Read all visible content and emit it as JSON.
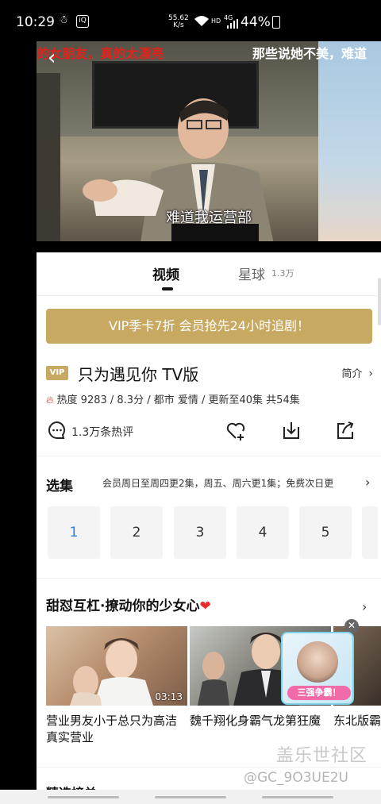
{
  "status_bar": {
    "time": "10:29",
    "net_speed_value": "55.62",
    "net_speed_unit": "K/s",
    "hd": "HD",
    "network": "4G",
    "battery": "44%"
  },
  "video": {
    "marquee_left": "的女朋友，真的太漂亮",
    "marquee_right": "那些说她不美，难道",
    "subtitle": "难道我运营部"
  },
  "tabs": {
    "video": "视频",
    "star": "星球",
    "star_count": "1.3万"
  },
  "vip_banner": "VIP季卡7折 会员抢先24小时追剧！",
  "show": {
    "vip_badge": "VIP",
    "title": "只为遇见你 TV版",
    "intro": "简介",
    "meta": "热度 9283 / 8.3分 / 都市 爱情 / 更新至40集 共54集",
    "comments": "1.3万条热评"
  },
  "episodes": {
    "heading": "选集",
    "note": "会员周日至周四更2集，周五、周六更1集；免费次日更",
    "list": [
      "1",
      "2",
      "3",
      "4",
      "5"
    ]
  },
  "recommend": {
    "heading": "甜怼互杠·撩动你的少女心",
    "items": [
      {
        "caption": "营业男友小于总只为高洁真实营业",
        "duration": "03:13"
      },
      {
        "caption": "魏千翔化身霸气龙第狂魔",
        "duration": ""
      },
      {
        "caption": "东北版霸",
        "duration": ""
      }
    ],
    "ad_label": "三强争霸！"
  },
  "next_section": "精选榜单",
  "watermark": {
    "line1": "盖乐世社区",
    "line2": "@GC_9O3UE2U"
  },
  "colors": {
    "vip_gold": "#c8a961",
    "episode_active": "#2a7fd4",
    "flame": "#e8232e"
  }
}
